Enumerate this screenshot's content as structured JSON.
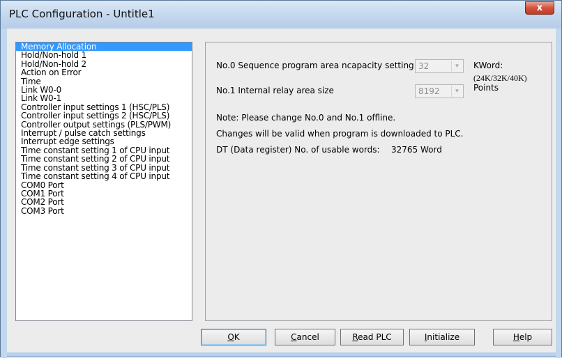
{
  "window": {
    "title": "PLC Configuration - Untitle1",
    "close_symbol": "x"
  },
  "sidebar": {
    "items": [
      {
        "label": "Memory Allocation",
        "selected": true
      },
      {
        "label": "Hold/Non-hold 1"
      },
      {
        "label": "Hold/Non-hold 2"
      },
      {
        "label": "Action on Error"
      },
      {
        "label": "Time"
      },
      {
        "label": "Link W0-0"
      },
      {
        "label": "Link W0-1"
      },
      {
        "label": "Controller input settings 1 (HSC/PLS)"
      },
      {
        "label": "Controller input settings 2 (HSC/PLS)"
      },
      {
        "label": "Controller output settings (PLS/PWM)"
      },
      {
        "label": "Interrupt / pulse catch settings"
      },
      {
        "label": "Interrupt edge settings"
      },
      {
        "label": "Time constant setting 1 of CPU input"
      },
      {
        "label": "Time constant setting 2 of CPU input"
      },
      {
        "label": "Time constant setting 3 of CPU input"
      },
      {
        "label": "Time constant setting 4 of CPU input"
      },
      {
        "label": "COM0 Port"
      },
      {
        "label": "COM1 Port"
      },
      {
        "label": "COM2 Port"
      },
      {
        "label": "COM3 Port"
      }
    ]
  },
  "panel": {
    "setting0_label": "No.0 Sequence program area ncapacity setting",
    "setting0_value": "32",
    "setting0_unit": "KWord:",
    "setting0_options": "(24K/32K/40K)",
    "setting1_label": "No.1 Internal relay area size",
    "setting1_value": "8192",
    "setting1_unit": "Points",
    "note1": "Note: Please change No.0 and No.1 offline.",
    "note2": "Changes will be valid when program is downloaded to PLC.",
    "dt_label": "DT (Data register) No. of usable words:",
    "dt_value": "32765 Word"
  },
  "buttons": {
    "ok": {
      "accel": "O",
      "rest": "K"
    },
    "cancel": {
      "accel": "C",
      "rest": "ancel"
    },
    "read_plc": {
      "accel": "R",
      "rest": "ead PLC"
    },
    "initialize": {
      "accel": "I",
      "rest": "nitialize"
    },
    "help": {
      "accel": "H",
      "rest": "elp"
    }
  },
  "icons": {
    "dropdown": "chevron-down-icon",
    "close": "close-icon"
  },
  "colors": {
    "selection": "#3399ff",
    "titlebar": "#c3d7ed",
    "close_button": "#d4523d"
  }
}
